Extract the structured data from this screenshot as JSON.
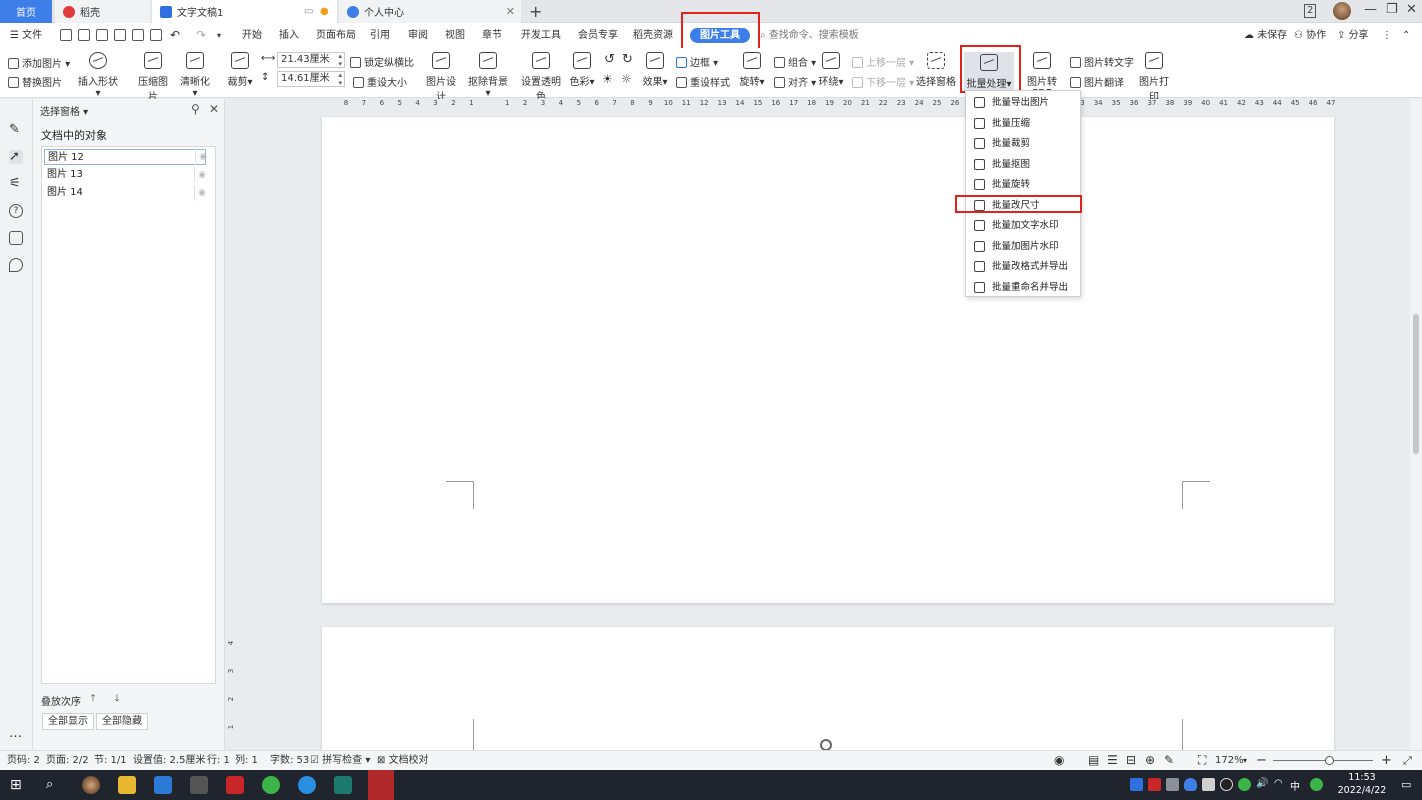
{
  "tabs": {
    "home": "首页",
    "daoke": "稻壳",
    "doc": "文字文稿1",
    "center": "个人中心",
    "page_count_badge": "2"
  },
  "menu": {
    "file": "文件",
    "items": [
      "开始",
      "插入",
      "页面布局",
      "引用",
      "审阅",
      "视图",
      "章节",
      "开发工具",
      "会员专享",
      "稻壳资源"
    ],
    "active_tab": "图片工具",
    "search_placeholder": "查找命令、搜索模板",
    "unsaved": "未保存",
    "collab": "协作",
    "share": "分享"
  },
  "ribbon": {
    "add_image": "添加图片",
    "replace_image": "替换图片",
    "insert_shape": "插入形状",
    "compress": "压缩图片",
    "clarity": "清晰化",
    "crop": "裁剪",
    "width_value": "21.43厘米",
    "height_value": "14.61厘米",
    "lock_ratio": "锁定纵横比",
    "reset_size": "重设大小",
    "image_design": "图片设计",
    "remove_bg": "抠除背景",
    "set_transparent": "设置透明色",
    "color": "色彩",
    "effects": "效果",
    "border": "边框",
    "reset_style": "重设样式",
    "rotate": "旋转",
    "group": "组合",
    "align": "对齐",
    "wrap": "环绕",
    "bring_forward": "上移一层",
    "send_backward": "下移一层",
    "selection_pane": "选择窗格",
    "batch": "批量处理",
    "to_pdf": "图片转PDF",
    "to_text": "图片转文字",
    "translate": "图片翻译",
    "print": "图片打印"
  },
  "batch_menu": [
    "批量导出图片",
    "批量压缩",
    "批量裁剪",
    "批量抠图",
    "批量旋转",
    "批量改尺寸",
    "批量加文字水印",
    "批量加图片水印",
    "批量改格式并导出",
    "批量重命名并导出"
  ],
  "selection_pane": {
    "title": "选择窗格",
    "subtitle": "文档中的对象",
    "objects": [
      "图片 12",
      "图片 13",
      "图片 14"
    ],
    "order_label": "叠放次序",
    "show_all": "全部显示",
    "hide_all": "全部隐藏"
  },
  "ruler": {
    "ticks": [
      "8",
      "7",
      "6",
      "5",
      "4",
      "3",
      "2",
      "1",
      "",
      "1",
      "2",
      "3",
      "4",
      "5",
      "6",
      "7",
      "8",
      "9",
      "10",
      "11",
      "12",
      "13",
      "14",
      "15",
      "16",
      "17",
      "18",
      "19",
      "20",
      "21",
      "22",
      "23",
      "24",
      "25",
      "26",
      "27",
      "28",
      "29",
      "30",
      "31",
      "32",
      "33",
      "34",
      "35",
      "36",
      "37",
      "38",
      "39",
      "40",
      "41",
      "42",
      "43",
      "44",
      "45",
      "46",
      "47"
    ],
    "vticks": [
      "4",
      "3",
      "2",
      "1"
    ]
  },
  "status": {
    "page": "页码: 2",
    "pages": "页面: 2/2",
    "section": "节: 1/1",
    "setting": "设置值: 2.5厘米",
    "row": "行: 1",
    "col": "列: 1",
    "words": "字数: 53",
    "spell": "拼写检查",
    "proof": "文档校对",
    "zoom": "172%"
  },
  "taskbar": {
    "time": "11:53",
    "date": "2022/4/22",
    "ime": "中"
  }
}
